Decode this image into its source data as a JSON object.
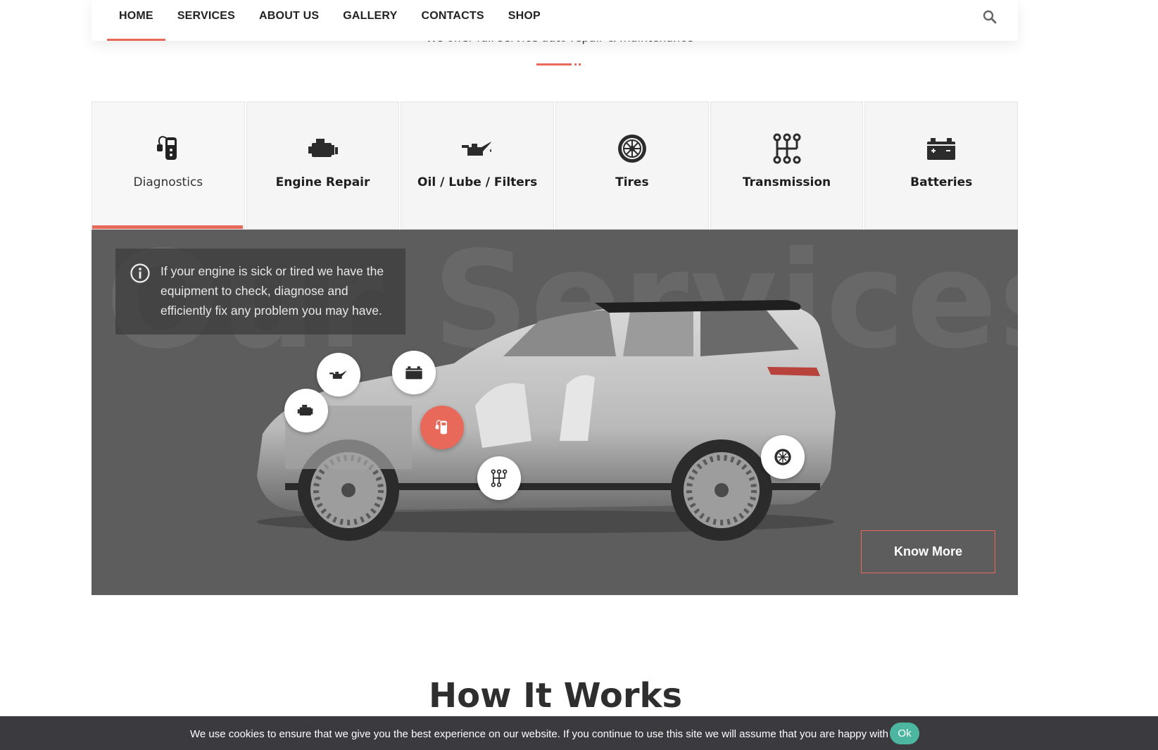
{
  "nav": {
    "items": [
      {
        "label": "HOME",
        "active": true
      },
      {
        "label": "SERVICES"
      },
      {
        "label": "ABOUT US"
      },
      {
        "label": "GALLERY"
      },
      {
        "label": "CONTACTS"
      },
      {
        "label": "SHOP"
      }
    ],
    "search_icon": "search-icon"
  },
  "intro": {
    "subtitle": "We offer full service auto repair & maintenance"
  },
  "tabs": [
    {
      "label": "Diagnostics",
      "icon": "diagnostics-icon",
      "active": true
    },
    {
      "label": "Engine Repair",
      "icon": "engine-icon"
    },
    {
      "label": "Oil / Lube / Filters",
      "icon": "oil-can-icon"
    },
    {
      "label": "Tires",
      "icon": "tire-icon"
    },
    {
      "label": "Transmission",
      "icon": "gearshift-icon"
    },
    {
      "label": "Batteries",
      "icon": "battery-icon"
    }
  ],
  "showcase": {
    "background_word": "Our Services",
    "info_text": "If your engine is sick or tired we have the equipment to check, diagnose and efficiently fix any problem you may have.",
    "button_label": "Know More"
  },
  "how_it_works": {
    "title": "How It Works"
  },
  "cookie": {
    "text": "We use cookies to ensure that we give you the best experience on our website. If you continue to use this site we will assume that you are happy with it.",
    "button_label": "Ok"
  },
  "colors": {
    "accent": "#e8685a",
    "showcase_bg": "#5d5d5d",
    "cookie_bg": "#3a3a3f",
    "cookie_button": "#4db6a0"
  }
}
